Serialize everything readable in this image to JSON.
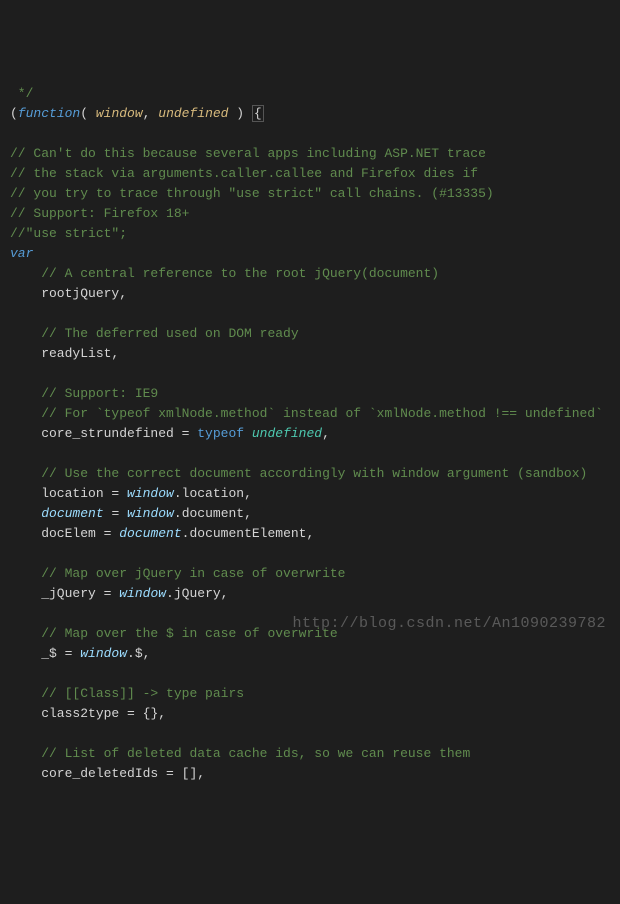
{
  "watermark": "http://blog.csdn.net/An1090239782",
  "code": {
    "lines": [
      [
        {
          "cls": "c-comment",
          "t": " */"
        }
      ],
      [
        {
          "cls": "c-punct",
          "t": "("
        },
        {
          "cls": "c-keyword-it",
          "t": "function"
        },
        {
          "cls": "c-punct",
          "t": "( "
        },
        {
          "cls": "c-param",
          "t": "window"
        },
        {
          "cls": "c-punct",
          "t": ", "
        },
        {
          "cls": "c-param",
          "t": "undefined"
        },
        {
          "cls": "c-punct",
          "t": " ) "
        },
        {
          "cls": "c-bracematch",
          "t": "{"
        }
      ],
      [],
      [
        {
          "cls": "c-comment",
          "t": "// Can't do this because several apps including ASP.NET trace"
        }
      ],
      [
        {
          "cls": "c-comment",
          "t": "// the stack via arguments.caller.callee and Firefox dies if"
        }
      ],
      [
        {
          "cls": "c-comment",
          "t": "// you try to trace through \"use strict\" call chains. (#13335)"
        }
      ],
      [
        {
          "cls": "c-comment",
          "t": "// Support: Firefox 18+"
        }
      ],
      [
        {
          "cls": "c-comment",
          "t": "//\"use strict\";"
        }
      ],
      [
        {
          "cls": "c-keyword-it",
          "t": "var"
        }
      ],
      [
        {
          "cls": "c-ident",
          "t": "    "
        },
        {
          "cls": "c-comment",
          "t": "// A central reference to the root jQuery(document)"
        }
      ],
      [
        {
          "cls": "c-ident",
          "t": "    rootjQuery"
        },
        {
          "cls": "c-punct",
          "t": ","
        }
      ],
      [],
      [
        {
          "cls": "c-ident",
          "t": "    "
        },
        {
          "cls": "c-comment",
          "t": "// The deferred used on DOM ready"
        }
      ],
      [
        {
          "cls": "c-ident",
          "t": "    readyList"
        },
        {
          "cls": "c-punct",
          "t": ","
        }
      ],
      [],
      [
        {
          "cls": "c-ident",
          "t": "    "
        },
        {
          "cls": "c-comment",
          "t": "// Support: IE9"
        }
      ],
      [
        {
          "cls": "c-ident",
          "t": "    "
        },
        {
          "cls": "c-comment",
          "t": "// For `typeof xmlNode.method` instead of `xmlNode.method !== undefined`"
        }
      ],
      [
        {
          "cls": "c-ident",
          "t": "    core_strundefined "
        },
        {
          "cls": "c-op",
          "t": "= "
        },
        {
          "cls": "c-keyword",
          "t": "typeof"
        },
        {
          "cls": "c-ident",
          "t": " "
        },
        {
          "cls": "c-type",
          "t": "undefined"
        },
        {
          "cls": "c-punct",
          "t": ","
        }
      ],
      [],
      [
        {
          "cls": "c-ident",
          "t": "    "
        },
        {
          "cls": "c-comment",
          "t": "// Use the correct document accordingly with window argument (sandbox)"
        }
      ],
      [
        {
          "cls": "c-ident",
          "t": "    location "
        },
        {
          "cls": "c-op",
          "t": "= "
        },
        {
          "cls": "c-varit",
          "t": "window"
        },
        {
          "cls": "c-punct",
          "t": "."
        },
        {
          "cls": "c-ident",
          "t": "location"
        },
        {
          "cls": "c-punct",
          "t": ","
        }
      ],
      [
        {
          "cls": "c-ident",
          "t": "    "
        },
        {
          "cls": "c-varit",
          "t": "document"
        },
        {
          "cls": "c-ident",
          "t": " "
        },
        {
          "cls": "c-op",
          "t": "= "
        },
        {
          "cls": "c-varit",
          "t": "window"
        },
        {
          "cls": "c-punct",
          "t": "."
        },
        {
          "cls": "c-ident",
          "t": "document"
        },
        {
          "cls": "c-punct",
          "t": ","
        }
      ],
      [
        {
          "cls": "c-ident",
          "t": "    docElem "
        },
        {
          "cls": "c-op",
          "t": "= "
        },
        {
          "cls": "c-varit",
          "t": "document"
        },
        {
          "cls": "c-punct",
          "t": "."
        },
        {
          "cls": "c-ident",
          "t": "documentElement"
        },
        {
          "cls": "c-punct",
          "t": ","
        }
      ],
      [],
      [
        {
          "cls": "c-ident",
          "t": "    "
        },
        {
          "cls": "c-comment",
          "t": "// Map over jQuery in case of overwrite"
        }
      ],
      [
        {
          "cls": "c-ident",
          "t": "    _jQuery "
        },
        {
          "cls": "c-op",
          "t": "= "
        },
        {
          "cls": "c-varit",
          "t": "window"
        },
        {
          "cls": "c-punct",
          "t": "."
        },
        {
          "cls": "c-ident",
          "t": "jQuery"
        },
        {
          "cls": "c-punct",
          "t": ","
        }
      ],
      [],
      [
        {
          "cls": "c-ident",
          "t": "    "
        },
        {
          "cls": "c-comment",
          "t": "// Map over the $ in case of overwrite"
        }
      ],
      [
        {
          "cls": "c-ident",
          "t": "    _$ "
        },
        {
          "cls": "c-op",
          "t": "= "
        },
        {
          "cls": "c-varit",
          "t": "window"
        },
        {
          "cls": "c-punct",
          "t": "."
        },
        {
          "cls": "c-ident",
          "t": "$"
        },
        {
          "cls": "c-punct",
          "t": ","
        }
      ],
      [],
      [
        {
          "cls": "c-ident",
          "t": "    "
        },
        {
          "cls": "c-comment",
          "t": "// [[Class]] -> type pairs"
        }
      ],
      [
        {
          "cls": "c-ident",
          "t": "    class2type "
        },
        {
          "cls": "c-op",
          "t": "= "
        },
        {
          "cls": "c-brace",
          "t": "{}"
        },
        {
          "cls": "c-punct",
          "t": ","
        }
      ],
      [],
      [
        {
          "cls": "c-ident",
          "t": "    "
        },
        {
          "cls": "c-comment",
          "t": "// List of deleted data cache ids, so we can reuse them"
        }
      ],
      [
        {
          "cls": "c-ident",
          "t": "    core_deletedIds "
        },
        {
          "cls": "c-op",
          "t": "= "
        },
        {
          "cls": "c-brace",
          "t": "[]"
        },
        {
          "cls": "c-punct",
          "t": ","
        }
      ]
    ]
  }
}
